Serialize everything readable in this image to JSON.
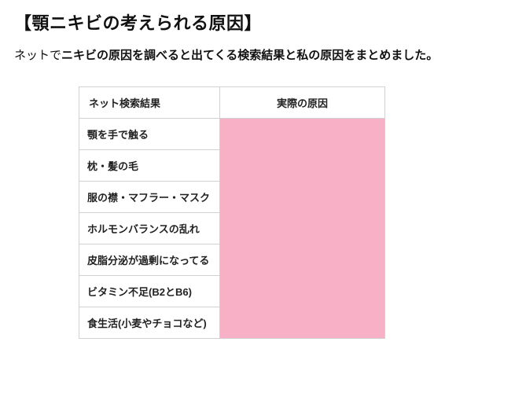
{
  "heading": "【顎ニキビの考えられる原因】",
  "intro": {
    "prefix": "ネットで",
    "bold": "ニキビの原因を調べると出てくる検索結果と私の原因をまとめました。"
  },
  "table": {
    "head_left": "ネット検索結果",
    "head_right": "実際の原因",
    "rows": [
      "顎を手で触る",
      "枕・髪の毛",
      "服の襟・マフラー・マスク",
      "ホルモンバランスの乱れ",
      "皮脂分泌が過剰になってる",
      "ビタミン不足(B2とB6)",
      "食生活(小麦やチョコなど)"
    ]
  }
}
